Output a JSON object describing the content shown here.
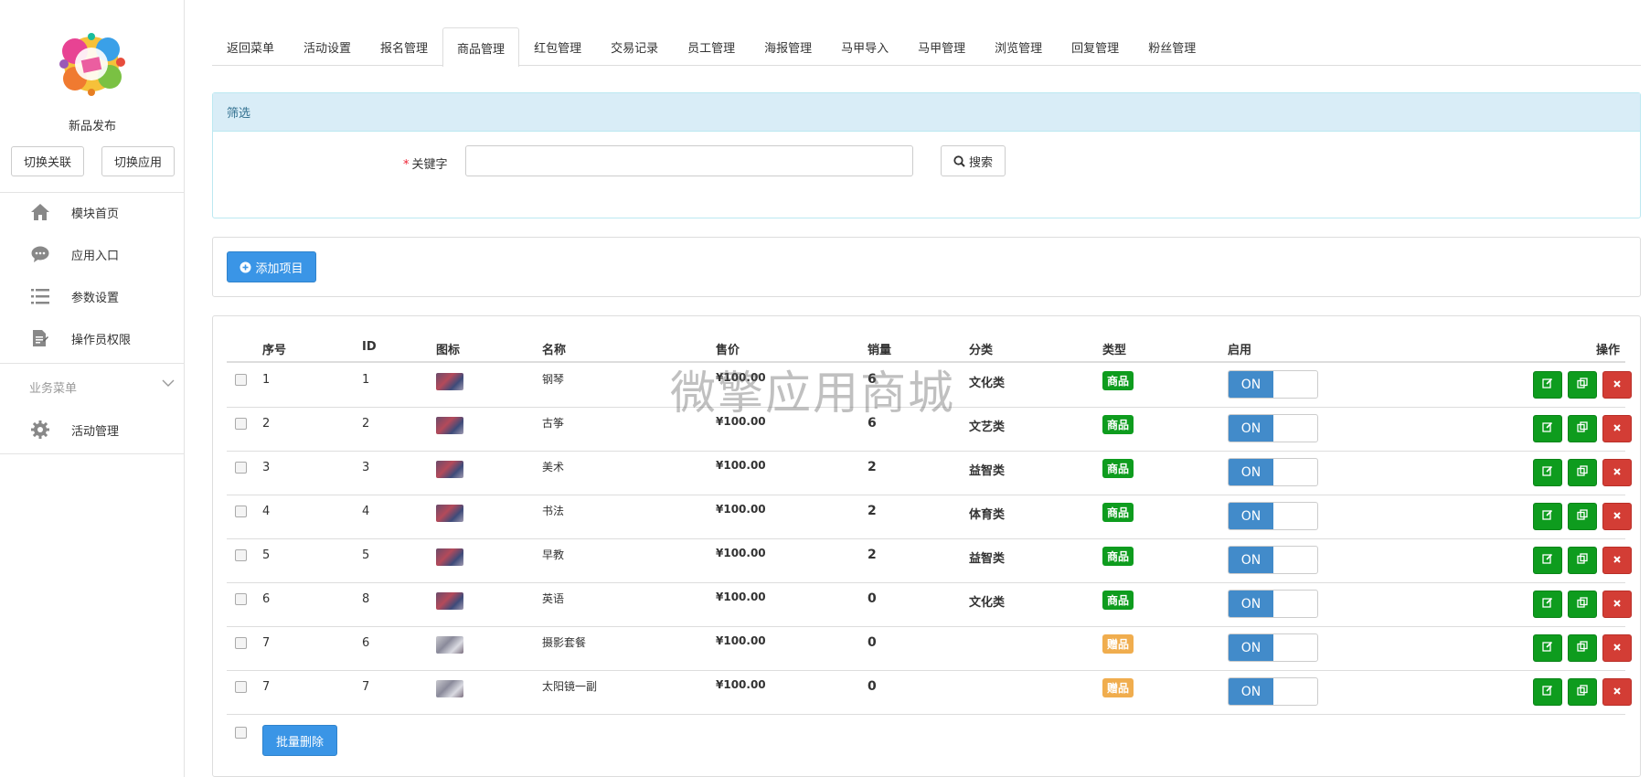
{
  "sidebar": {
    "app_name": "新品发布",
    "switch_link_label": "切换关联",
    "switch_app_label": "切换应用",
    "nav": [
      {
        "label": "模块首页",
        "icon": "home-icon"
      },
      {
        "label": "应用入口",
        "icon": "comment-icon"
      },
      {
        "label": "参数设置",
        "icon": "list-icon"
      },
      {
        "label": "操作员权限",
        "icon": "document-edit-icon"
      }
    ],
    "section_title": "业务菜单",
    "business_nav": [
      {
        "label": "活动管理",
        "icon": "gear-icon"
      }
    ]
  },
  "tabs": [
    {
      "label": "返回菜单",
      "active": false
    },
    {
      "label": "活动设置",
      "active": false
    },
    {
      "label": "报名管理",
      "active": false
    },
    {
      "label": "商品管理",
      "active": true
    },
    {
      "label": "红包管理",
      "active": false
    },
    {
      "label": "交易记录",
      "active": false
    },
    {
      "label": "员工管理",
      "active": false
    },
    {
      "label": "海报管理",
      "active": false
    },
    {
      "label": "马甲导入",
      "active": false
    },
    {
      "label": "马甲管理",
      "active": false
    },
    {
      "label": "浏览管理",
      "active": false
    },
    {
      "label": "回复管理",
      "active": false
    },
    {
      "label": "粉丝管理",
      "active": false
    }
  ],
  "filter": {
    "title": "筛选",
    "required_mark": "*",
    "keyword_label": "关键字",
    "keyword_value": "",
    "search_label": "搜索"
  },
  "add_button_label": "添加项目",
  "table": {
    "headers": {
      "seq": "序号",
      "id": "ID",
      "icon": "图标",
      "name": "名称",
      "price": "售价",
      "sales": "销量",
      "category": "分类",
      "type": "类型",
      "enabled": "启用",
      "actions": "操作"
    },
    "rows": [
      {
        "seq": "1",
        "id": "1",
        "thumb": "t1",
        "name": "钢琴",
        "price": "¥100.00",
        "sales": "6",
        "category": "文化类",
        "type": "商品",
        "type_color": "#0e9c1e",
        "enabled": "ON"
      },
      {
        "seq": "2",
        "id": "2",
        "thumb": "t1",
        "name": "古筝",
        "price": "¥100.00",
        "sales": "6",
        "category": "文艺类",
        "type": "商品",
        "type_color": "#0e9c1e",
        "enabled": "ON"
      },
      {
        "seq": "3",
        "id": "3",
        "thumb": "t1",
        "name": "美术",
        "price": "¥100.00",
        "sales": "2",
        "category": "益智类",
        "type": "商品",
        "type_color": "#0e9c1e",
        "enabled": "ON"
      },
      {
        "seq": "4",
        "id": "4",
        "thumb": "t1",
        "name": "书法",
        "price": "¥100.00",
        "sales": "2",
        "category": "体育类",
        "type": "商品",
        "type_color": "#0e9c1e",
        "enabled": "ON"
      },
      {
        "seq": "5",
        "id": "5",
        "thumb": "t1",
        "name": "早教",
        "price": "¥100.00",
        "sales": "2",
        "category": "益智类",
        "type": "商品",
        "type_color": "#0e9c1e",
        "enabled": "ON"
      },
      {
        "seq": "6",
        "id": "8",
        "thumb": "t1",
        "name": "英语",
        "price": "¥100.00",
        "sales": "0",
        "category": "文化类",
        "type": "商品",
        "type_color": "#0e9c1e",
        "enabled": "ON"
      },
      {
        "seq": "7",
        "id": "6",
        "thumb": "t2",
        "name": "摄影套餐",
        "price": "¥100.00",
        "sales": "0",
        "category": "",
        "type": "赠品",
        "type_color": "#f0ad4e",
        "enabled": "ON"
      },
      {
        "seq": "7",
        "id": "7",
        "thumb": "t2",
        "name": "太阳镜一副",
        "price": "¥100.00",
        "sales": "0",
        "category": "",
        "type": "赠品",
        "type_color": "#f0ad4e",
        "enabled": "ON"
      }
    ]
  },
  "bulk_delete_label": "批量删除",
  "watermark": "微擎应用商城"
}
